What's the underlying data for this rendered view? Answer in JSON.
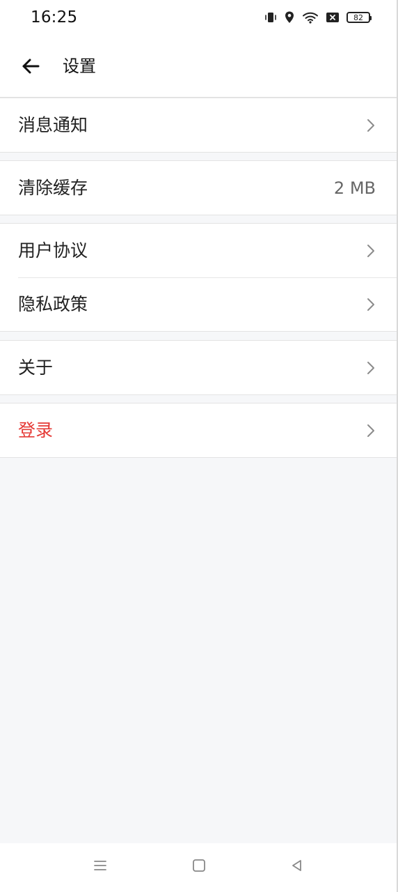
{
  "status_bar": {
    "time": "16:25",
    "battery": "82",
    "icons": [
      "vibrate-icon",
      "location-icon",
      "wifi-icon",
      "close-box-icon",
      "battery-icon"
    ]
  },
  "header": {
    "title": "设置",
    "back_icon": "back-arrow-icon"
  },
  "groups": [
    {
      "items": [
        {
          "label": "消息通知",
          "value": "",
          "has_chevron": true
        }
      ]
    },
    {
      "items": [
        {
          "label": "清除缓存",
          "value": "2 MB",
          "has_chevron": false
        }
      ]
    },
    {
      "items": [
        {
          "label": "用户协议",
          "value": "",
          "has_chevron": true
        },
        {
          "label": "隐私政策",
          "value": "",
          "has_chevron": true
        }
      ]
    },
    {
      "items": [
        {
          "label": "关于",
          "value": "",
          "has_chevron": true
        }
      ]
    },
    {
      "items": [
        {
          "label": "登录",
          "value": "",
          "has_chevron": true,
          "color": "#e53935"
        }
      ]
    }
  ],
  "nav_bar": {
    "icons": [
      "menu-icon",
      "home-square-icon",
      "back-triangle-icon"
    ]
  },
  "colors": {
    "background": "#f6f7f9",
    "surface": "#ffffff",
    "text": "#222222",
    "secondary_text": "#666666",
    "danger": "#e53935",
    "divider": "#e3e3e3"
  }
}
